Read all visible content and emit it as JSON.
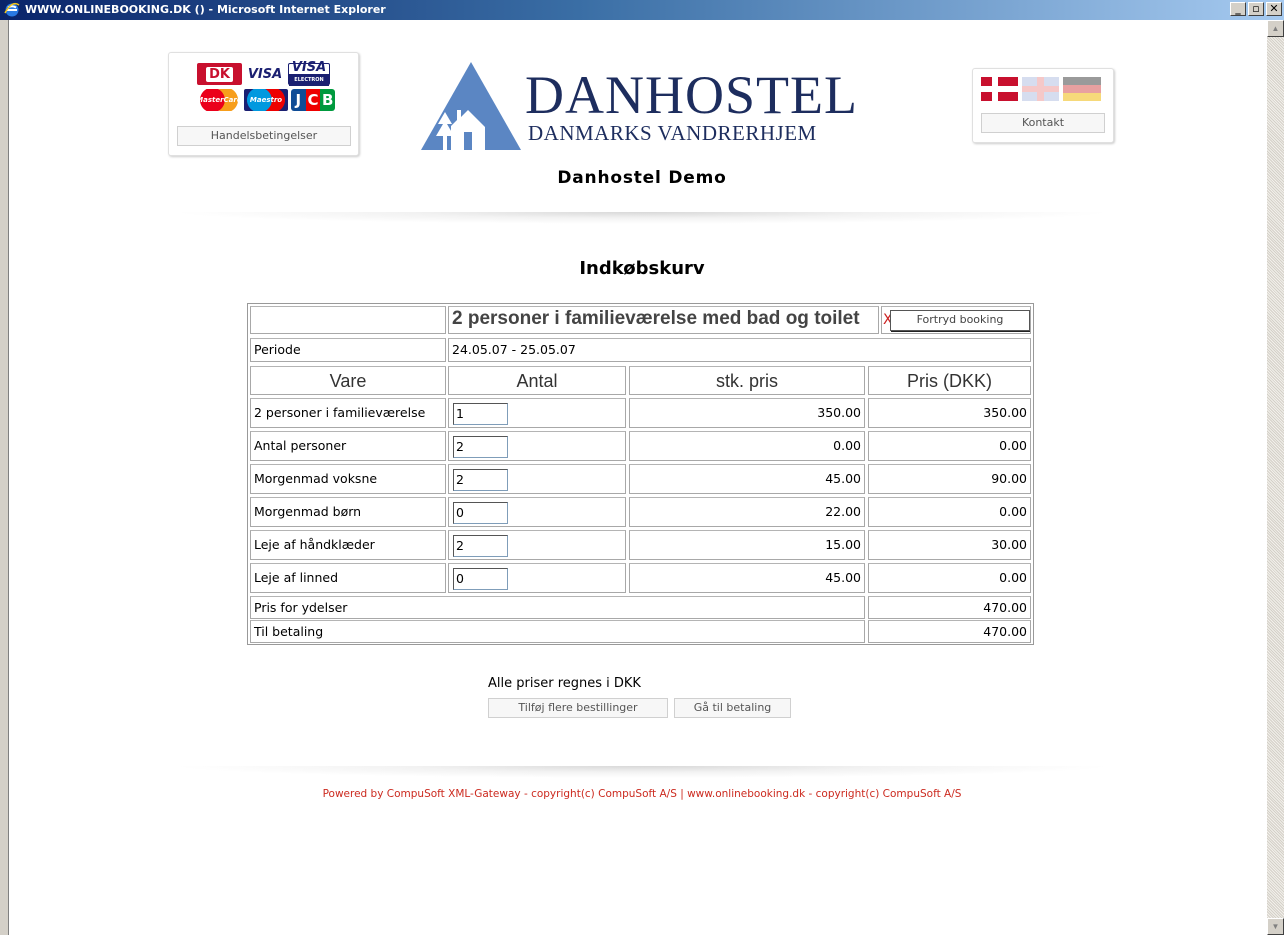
{
  "window": {
    "title": "WWW.ONLINEBOOKING.DK () - Microsoft Internet Explorer",
    "minimize": "_",
    "maximize": "▫",
    "close": "✕"
  },
  "header": {
    "payment_cards": [
      "DK",
      "VISA",
      "VISA",
      "MasterCard",
      "Maestro",
      "JCB"
    ],
    "terms_button": "Handelsbetingelser",
    "logo_name": "DANHOSTEL",
    "logo_subtitle": "DANMARKS VANDRERHJEM",
    "site_name": "Danhostel Demo",
    "flags": [
      "danish-flag-icon",
      "uk-flag-icon",
      "german-flag-icon"
    ],
    "contact_button": "Kontakt"
  },
  "page": {
    "title": "Indkøbskurv"
  },
  "basket": {
    "product_title": "2 personer i familieværelse med bad og toilet",
    "cancel_x": "X",
    "cancel_button": "Fortryd booking",
    "period_label": "Periode",
    "period_value": "24.05.07 - 25.05.07",
    "columns": [
      "Vare",
      "Antal",
      "stk. pris",
      "Pris (DKK)"
    ],
    "rows": [
      {
        "item": "2 personer i familieværelse",
        "qty": "1",
        "unit": "350.00",
        "total": "350.00"
      },
      {
        "item": "Antal personer",
        "qty": "2",
        "unit": "0.00",
        "total": "0.00"
      },
      {
        "item": "Morgenmad voksne",
        "qty": "2",
        "unit": "45.00",
        "total": "90.00"
      },
      {
        "item": "Morgenmad børn",
        "qty": "0",
        "unit": "22.00",
        "total": "0.00"
      },
      {
        "item": "Leje af håndklæder",
        "qty": "2",
        "unit": "15.00",
        "total": "30.00"
      },
      {
        "item": "Leje af linned",
        "qty": "0",
        "unit": "45.00",
        "total": "0.00"
      }
    ],
    "services_label": "Pris for ydelser",
    "services_value": "470.00",
    "payment_label": "Til betaling",
    "payment_value": "470.00"
  },
  "actions": {
    "note": "Alle priser regnes i DKK",
    "add_more": "Tilføj flere bestillinger",
    "go_pay": "Gå til betaling"
  },
  "footer": {
    "text": "Powered by CompuSoft XML-Gateway - copyright(c) CompuSoft A/S  |  www.onlinebooking.dk - copyright(c) CompuSoft A/S"
  },
  "colors": {
    "brand_blue": "#1d2d5e",
    "logo_blue": "#5b86c3",
    "footer_red": "#cc2a1f"
  }
}
